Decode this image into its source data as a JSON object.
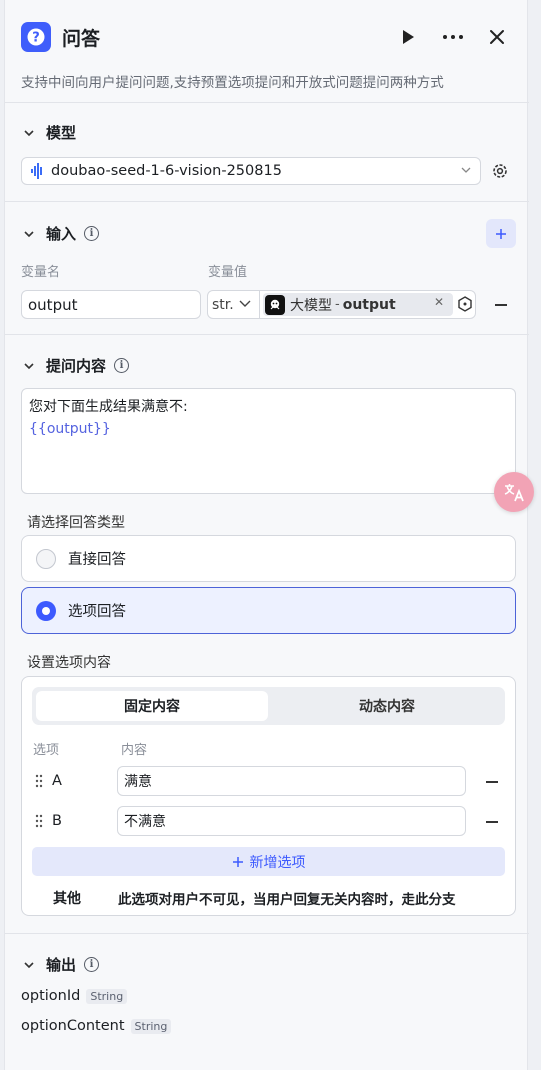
{
  "header": {
    "title": "问答",
    "description": "支持中间向用户提问问题,支持预置选项提问和开放式问题提问两种方式"
  },
  "model_section": {
    "title": "模型",
    "model_name": "doubao-seed-1-6-vision-250815"
  },
  "input_section": {
    "title": "输入",
    "col_var_name": "变量名",
    "col_var_value": "变量值",
    "var_name_value": "output",
    "type_value": "str.",
    "ref_node": "大模型",
    "ref_sep": "-",
    "ref_field": "output"
  },
  "question_section": {
    "title": "提问内容",
    "line1": "您对下面生成结果满意不:",
    "line2": "{{output}}"
  },
  "answer_type": {
    "label": "请选择回答类型",
    "option_direct": "直接回答",
    "option_choice": "选项回答",
    "selected": "选项回答"
  },
  "options_section": {
    "label": "设置选项内容",
    "tab_fixed": "固定内容",
    "tab_dynamic": "动态内容",
    "active_tab": "固定内容",
    "col_option": "选项",
    "col_content": "内容",
    "rows": [
      {
        "key": "A",
        "value": "满意"
      },
      {
        "key": "B",
        "value": "不满意"
      }
    ],
    "add_label": "新增选项",
    "other_key": "其他",
    "other_desc": "此选项对用户不可见，当用户回复无关内容时，走此分支"
  },
  "output_section": {
    "title": "输出",
    "fields": [
      {
        "name": "optionId",
        "type": "String"
      },
      {
        "name": "optionContent",
        "type": "String"
      }
    ]
  },
  "colors": {
    "accent": "#3d5afe",
    "header_icon": "#3f5efb",
    "translate_badge": "#f08aa2"
  },
  "icons": {
    "header": "question-mark-icon",
    "run": "play-icon",
    "more": "more-dots-icon",
    "close": "close-icon",
    "model": "waveform-icon",
    "settings": "gear-icon",
    "translate": "translate-icon"
  }
}
